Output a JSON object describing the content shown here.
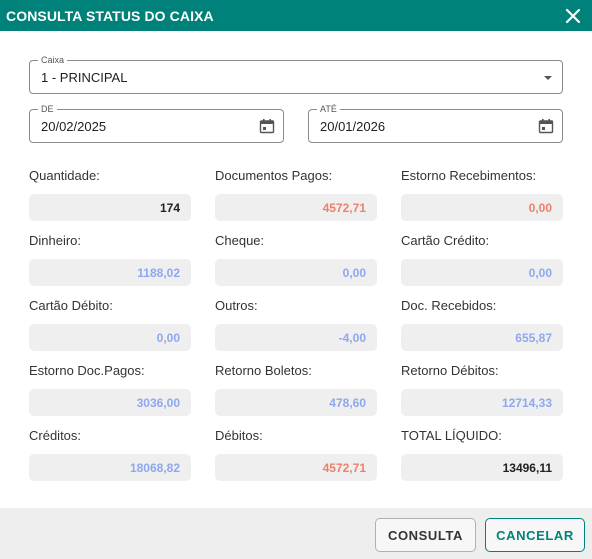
{
  "dialog": {
    "title": "CONSULTA STATUS DO CAIXA"
  },
  "form": {
    "caixa": {
      "legend": "Caixa",
      "value": "1 - PRINCIPAL"
    },
    "de": {
      "legend": "DE",
      "value": "20/02/2025"
    },
    "ate": {
      "legend": "ATÉ",
      "value": "20/01/2026"
    }
  },
  "stats": [
    {
      "label": "Quantidade:",
      "value": "174",
      "color": "#222222"
    },
    {
      "label": "Documentos Pagos:",
      "value": "4572,71",
      "color": "#f0806a"
    },
    {
      "label": "Estorno Recebimentos:",
      "value": "0,00",
      "color": "#f0806a"
    },
    {
      "label": "Dinheiro:",
      "value": "1188,02",
      "color": "#8ea8f0"
    },
    {
      "label": "Cheque:",
      "value": "0,00",
      "color": "#8ea8f0"
    },
    {
      "label": "Cartão Crédito:",
      "value": "0,00",
      "color": "#8ea8f0"
    },
    {
      "label": "Cartão Débito:",
      "value": "0,00",
      "color": "#8ea8f0"
    },
    {
      "label": "Outros:",
      "value": "-4,00",
      "color": "#8ea8f0"
    },
    {
      "label": "Doc. Recebidos:",
      "value": "655,87",
      "color": "#8ea8f0"
    },
    {
      "label": "Estorno Doc.Pagos:",
      "value": "3036,00",
      "color": "#8ea8f0"
    },
    {
      "label": "Retorno Boletos:",
      "value": "478,60",
      "color": "#8ea8f0"
    },
    {
      "label": "Retorno Débitos:",
      "value": "12714,33",
      "color": "#8ea8f0"
    },
    {
      "label": "Créditos:",
      "value": "18068,82",
      "color": "#8ea8f0"
    },
    {
      "label": "Débitos:",
      "value": "4572,71",
      "color": "#f0806a"
    },
    {
      "label": "TOTAL LÍQUIDO:",
      "value": "13496,11",
      "color": "#222222"
    }
  ],
  "buttons": {
    "consulta": "CONSULTA",
    "cancelar": "CANCELAR"
  },
  "colors": {
    "header": "#00827a",
    "accent": "#00827a"
  }
}
